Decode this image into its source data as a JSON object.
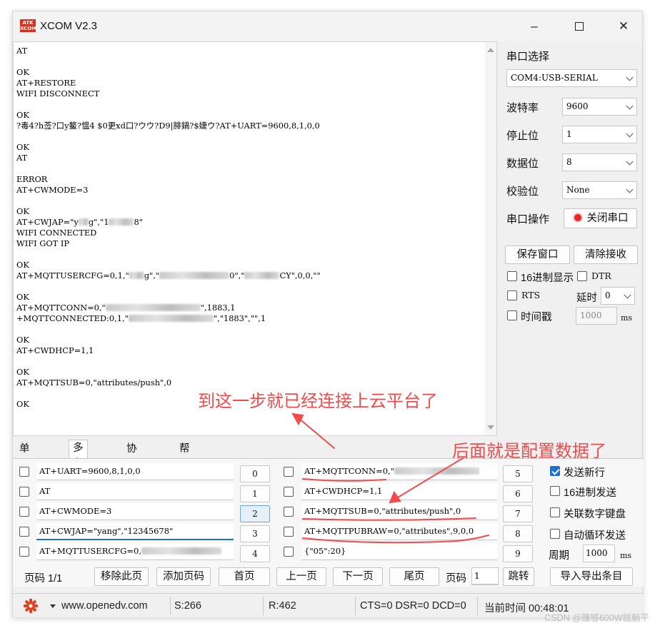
{
  "window": {
    "logo_text": "ATK XCOM",
    "title": "XCOM V2.3"
  },
  "receive_lines": [
    "AT",
    "",
    "OK",
    "AT+RESTORE",
    "WIFI DISCONNECT",
    "",
    "OK",
    "?毒4?h莶?口y鳌?慍4 $0更xd口?ウウ?D9|腓鍋?$婕ウ?AT+UART=9600,8,1,0,0",
    "",
    "OK",
    "AT",
    "",
    "ERROR",
    "AT+CWMODE=3",
    "",
    "OK",
    "AT+CWJAP=\"y▒▒g\",\"1▒▒▒▒▒8\"",
    "WIFI CONNECTED",
    "WIFI GOT IP",
    "",
    "OK",
    "AT+MQTTUSERCFG=0,1,\"▒▒▒g\",\"▒▒▒▒▒▒▒▒▒▒▒▒▒▒0\",\"▒▒▒▒▒▒▒CY\",0,0,\"\"",
    "",
    "OK",
    "AT+MQTTCONN=0,\"▒▒▒▒▒▒▒▒▒▒▒▒▒▒▒▒▒▒▒\",1883,1",
    "+MQTTCONNECTED:0,1,\"▒▒▒▒▒▒▒▒▒▒▒▒▒▒▒▒▒\",\"1883\",\"\",1",
    "",
    "OK",
    "AT+CWDHCP=1,1",
    "",
    "OK",
    "AT+MQTTSUB=0,\"attributes/push\",0",
    "",
    "OK"
  ],
  "annotations": {
    "connected_note": "到这一步就已经连接上云平台了",
    "config_note": "后面就是配置数据了"
  },
  "serial": {
    "port_label": "串口选择",
    "port_value": "COM4:USB-SERIAL",
    "baud_label": "波特率",
    "baud_value": "9600",
    "stop_label": "停止位",
    "stop_value": "1",
    "data_label": "数据位",
    "data_value": "8",
    "parity_label": "校验位",
    "parity_value": "None",
    "op_label": "串口操作",
    "op_button": "关闭串口"
  },
  "receive_opts": {
    "save_window": "保存窗口",
    "clear_receive": "清除接收",
    "hex_display": "16进制显示",
    "dtr": "DTR",
    "rts": "RTS",
    "delay_label": "延时",
    "delay_value": "0",
    "timestamp": "时间戳",
    "timestamp_value": "1000",
    "ms": "ms"
  },
  "tabs": [
    "单条发送",
    "多条发送",
    "协议传输",
    "帮助"
  ],
  "multi_send": [
    {
      "num": "0",
      "text": "AT+UART=9600,8,1,0,0"
    },
    {
      "num": "1",
      "text": "AT"
    },
    {
      "num": "2",
      "text": "AT+CWMODE=3"
    },
    {
      "num": "3",
      "text": "AT+CWJAP=\"yang\",\"12345678\""
    },
    {
      "num": "4",
      "text": "AT+MQTTUSERCFG=0,▒▒▒▒▒▒▒▒▒▒▒▒▒▒▒▒"
    },
    {
      "num": "5",
      "text": "AT+MQTTCONN=0,\"▒▒▒▒▒▒▒▒▒▒▒▒▒▒▒▒▒"
    },
    {
      "num": "6",
      "text": "AT+CWDHCP=1,1"
    },
    {
      "num": "7",
      "text": "AT+MQTTSUB=0,\"attributes/push\",0"
    },
    {
      "num": "8",
      "text": "AT+MQTTPUBRAW=0,\"attributes\",9,0,0"
    },
    {
      "num": "9",
      "text": "{\"05\":20}"
    }
  ],
  "send_opts": {
    "send_newline": "发送新行",
    "hex_send": "16进制发送",
    "link_numpad": "关联数字键盘",
    "auto_loop": "自动循环发送",
    "period_label": "周期",
    "period_value": "1000",
    "ms": "ms"
  },
  "pager": {
    "page_info": "页码 1/1",
    "remove_page": "移除此页",
    "add_page": "添加页码",
    "first": "首页",
    "prev": "上一页",
    "next": "下一页",
    "last": "尾页",
    "page_label": "页码",
    "page_value": "1",
    "jump": "跳转",
    "import_export": "导入导出条目"
  },
  "status": {
    "url": "www.openedv.com",
    "sent": "S:266",
    "recv": "R:462",
    "lines": "CTS=0 DSR=0 DCD=0",
    "time": "当前时间 00:48:01"
  },
  "watermark": "CSDN @赚够600W就躺平",
  "colors": {
    "annotation": "#f24b4b",
    "accent": "#1f6fd0",
    "gear": "#e0421f"
  }
}
